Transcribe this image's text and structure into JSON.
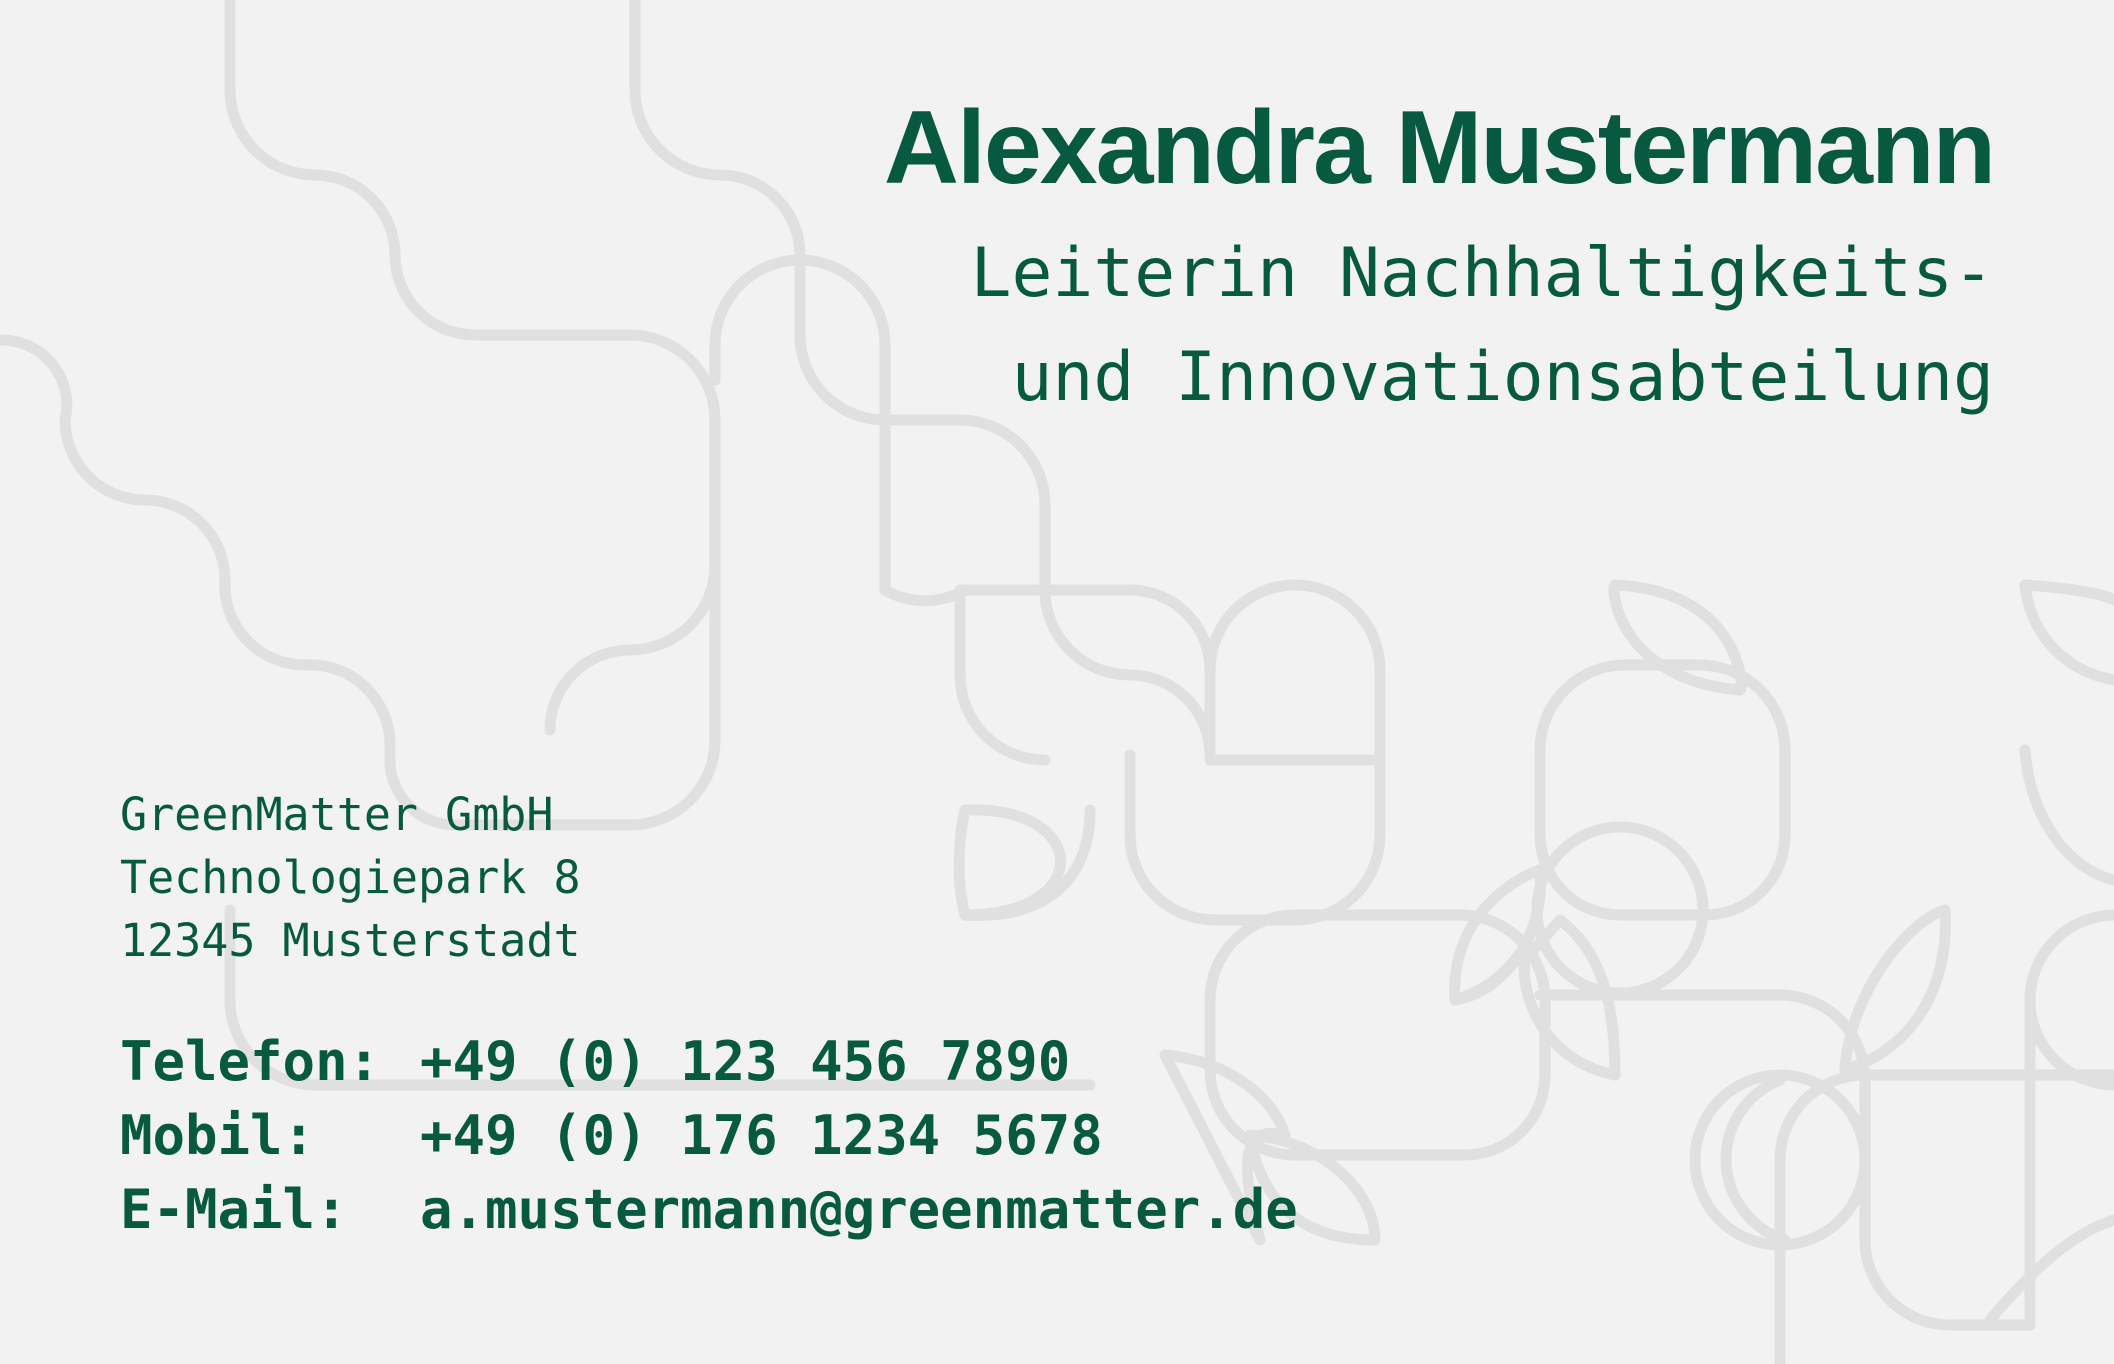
{
  "colors": {
    "background": "#f2f2f2",
    "text": "#075a3f",
    "pattern": "#e0e0e0"
  },
  "person": {
    "name": "Alexandra Mustermann",
    "title_line1": "Leiterin Nachhaltigkeits-",
    "title_line2": "und Innovationsabteilung"
  },
  "company": {
    "name": "GreenMatter GmbH",
    "street": "Technologiepark 8",
    "city": "12345 Musterstadt"
  },
  "contact": {
    "phone_label": "Telefon:",
    "phone": "+49 (0) 123 456 7890",
    "mobile_label": "Mobil:",
    "mobile": "+49 (0) 176 1234 5678",
    "email_label": "E-Mail:",
    "email": "a.mustermann@greenmatter.de"
  }
}
